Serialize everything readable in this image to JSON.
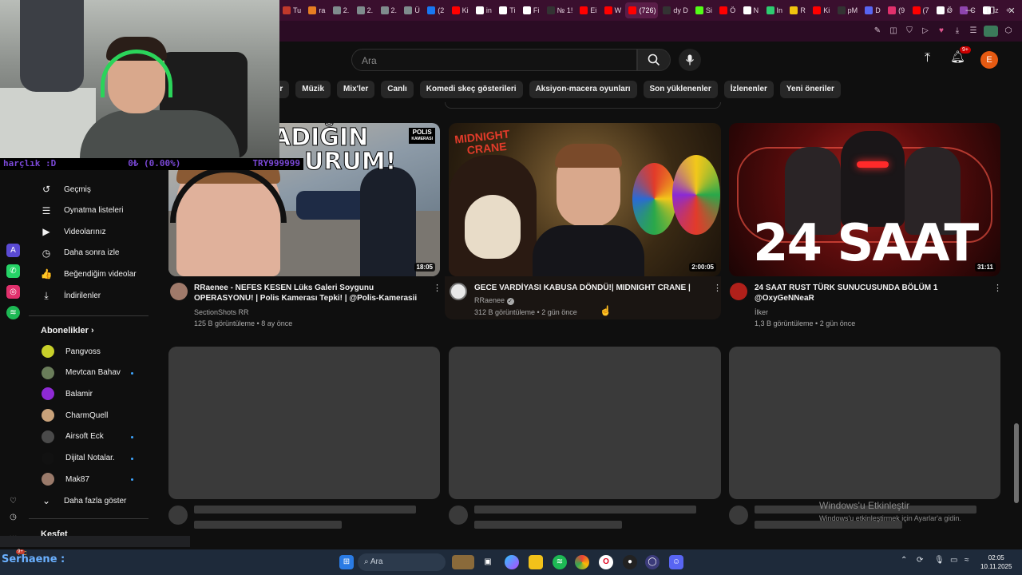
{
  "browser": {
    "tabs": [
      {
        "label": "Tu",
        "color": "#c0392b"
      },
      {
        "label": "ra",
        "color": "#e67e22"
      },
      {
        "label": "2.",
        "color": "#7f8c8d"
      },
      {
        "label": "2.",
        "color": "#7f8c8d"
      },
      {
        "label": "2.",
        "color": "#7f8c8d"
      },
      {
        "label": "Ü",
        "color": "#7f8c8d"
      },
      {
        "label": "(2",
        "color": "#1877f2"
      },
      {
        "label": "Ki",
        "color": "#ff0000"
      },
      {
        "label": "in",
        "color": "#ffffff"
      },
      {
        "label": "Ti",
        "color": "#ffffff"
      },
      {
        "label": "Fi",
        "color": "#ffffff"
      },
      {
        "label": "№ 1!",
        "color": "#333333"
      },
      {
        "label": "Ei",
        "color": "#ff0000"
      },
      {
        "label": "W",
        "color": "#ff0000"
      },
      {
        "label": "(726)",
        "color": "#ff0000",
        "active": true
      },
      {
        "label": "dy D",
        "color": "#333333"
      },
      {
        "label": "Si",
        "color": "#53fc18"
      },
      {
        "label": "Ö",
        "color": "#ff0000"
      },
      {
        "label": "N",
        "color": "#ffffff"
      },
      {
        "label": "In",
        "color": "#2ecc71"
      },
      {
        "label": "R",
        "color": "#f1c40f"
      },
      {
        "label": "Ki",
        "color": "#ff0000"
      },
      {
        "label": "pM",
        "color": "#333333"
      },
      {
        "label": "D",
        "color": "#5865f2"
      },
      {
        "label": "(9",
        "color": "#e1306c"
      },
      {
        "label": "(7",
        "color": "#ff0000"
      },
      {
        "label": "Ö",
        "color": "#ffffff"
      },
      {
        "label": "C",
        "color": "#8e44ad"
      },
      {
        "label": "iz",
        "color": "#ffffff"
      }
    ],
    "new_tab": "+"
  },
  "stream": {
    "overlay_left": "harçlık :D",
    "overlay_mid": "0₺ (0.00%)",
    "overlay_right": "TRY999999",
    "streamer_name": "Serhaene :"
  },
  "header": {
    "search_placeholder": "Ara",
    "notifications_badge": "9+",
    "avatar_letter": "E"
  },
  "chips": [
    "ler",
    "Müzik",
    "Mix'ler",
    "Canlı",
    "Komedi skeç gösterileri",
    "Aksiyon-macera oyunları",
    "Son yüklenenler",
    "İzlenenler",
    "Yeni öneriler"
  ],
  "sidebar": {
    "items": [
      {
        "label": "Geçmiş",
        "icon": "history-icon",
        "glyph": "↺"
      },
      {
        "label": "Oynatma listeleri",
        "icon": "playlist-icon",
        "glyph": "☰"
      },
      {
        "label": "Videolarınız",
        "icon": "your-videos-icon",
        "glyph": "▶"
      },
      {
        "label": "Daha sonra izle",
        "icon": "watch-later-icon",
        "glyph": "◷"
      },
      {
        "label": "Beğendiğim videolar",
        "icon": "like-icon",
        "glyph": "👍"
      },
      {
        "label": "İndirilenler",
        "icon": "download-icon",
        "glyph": "⤓"
      }
    ],
    "subscriptions_heading": "Abonelikler",
    "subscriptions": [
      {
        "name": "Pangvoss",
        "color": "#c8d02a",
        "live": false
      },
      {
        "name": "Mevtcan Bahav",
        "color": "#6a7d5a",
        "live": true
      },
      {
        "name": "Balamir",
        "color": "#8e2ad4",
        "live": false
      },
      {
        "name": "CharmQuell",
        "color": "#c9a27a",
        "live": false
      },
      {
        "name": "Airsoft Eck",
        "color": "#4a4a4a",
        "live": true
      },
      {
        "name": "Dijital Notalar.",
        "color": "#111111",
        "live": true
      },
      {
        "name": "Mak87",
        "color": "#9a7a6a",
        "live": true
      }
    ],
    "show_more": "Daha fazla göster",
    "explore_heading": "Keşfet"
  },
  "videos": [
    {
      "title_line1": "RRaenee - NEFES KESEN Lüks Galeri Soygunu",
      "title_line2": "OPERASYONU! | Polis Kamerası Tepki! | @Polis-Kamerasii",
      "channel": "SectionShots RR",
      "meta": "125 B görüntüleme • 8 ay önce",
      "duration": "18:05",
      "thumb_text": "ADIĞIN",
      "thumb_text2": "URUM!",
      "badge": "POLIS",
      "badge_sub": "KAMERASI"
    },
    {
      "title_line1": "GECE VARDİYASI KABUSA DÖNDÜ!| MIDNIGHT CRANE |",
      "title_line2": "",
      "channel": "RRaenee",
      "meta": "312 B görüntüleme • 2 gün önce",
      "duration": "2:00:05",
      "thumb_text": "MIDNIGHT",
      "thumb_text2": "CRANE"
    },
    {
      "title_line1": "24 SAAT RUST TÜRK SUNUCUSUNDA BÖLÜM 1",
      "title_line2": "@OxyGeNNeaR",
      "channel": "İlker",
      "meta": "1,3 B görüntüleme • 2 gün önce",
      "duration": "31:11",
      "thumb_text": "24 SAAT"
    }
  ],
  "watermark": {
    "title": "Windows'u Etkinleştir",
    "subtitle": "Windows'u etkinleştirmek için Ayarlar'a gidin."
  },
  "taskbar": {
    "search": "Ara",
    "time": "02:05",
    "date": "10.11.2025",
    "temp": "7°C",
    "notif_count": "9+"
  }
}
